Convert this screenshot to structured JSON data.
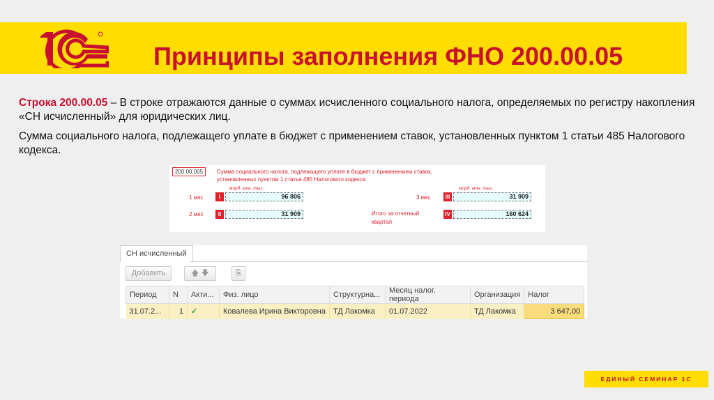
{
  "header": {
    "title": "Принципы заполнения ФНО 200.00.05",
    "logo_text": "1С"
  },
  "intro": {
    "line_bold": "Строка 200.00.05",
    "line_rest": " – В строке отражаются данные о суммах исчисленного социального налога, определяемых по регистру накопления «СН исчисленный» для юридических лиц.",
    "para2": "Сумма социального налога, подлежащего уплате в бюджет с применением ставок, установленных пунктом 1 статьи 485 Налогового кодекса."
  },
  "form": {
    "code": "200.00.005",
    "heading1": "Сумма социального налога, подлежащего уплате в бюджет  с применением ставок,",
    "heading2": "установленных пунктом 1 статьи 485 Налогового кодекса",
    "units": "млрд.   млн.   тыс.",
    "rows": [
      {
        "label": "1 мес",
        "roman": "I",
        "value": "96 806"
      },
      {
        "label": "2 мес",
        "roman": "II",
        "value": "31 909"
      },
      {
        "label": "3 мес",
        "roman": "III",
        "value": "31 909"
      },
      {
        "label": "Итого за отчетный квартал",
        "roman": "IV",
        "value": "160 624"
      }
    ]
  },
  "panel": {
    "tab": "СН исчисленный",
    "add_button": "Добавить",
    "columns": [
      "Период",
      "N",
      "Акти...",
      "Физ. лицо",
      "Структурна...",
      "Месяц налог. периода",
      "Организация",
      "Налог"
    ],
    "row": {
      "period": "31.07.2...",
      "n": "1",
      "active": "✓",
      "person": "Ковалева Ирина Викторовна",
      "unit": "ТД Лакомка",
      "month": "01.07.2022",
      "org": "ТД Лакомка",
      "tax": "3 647,00"
    }
  },
  "footer": {
    "label": "ЕДИНЫЙ СЕМИНАР 1С"
  }
}
